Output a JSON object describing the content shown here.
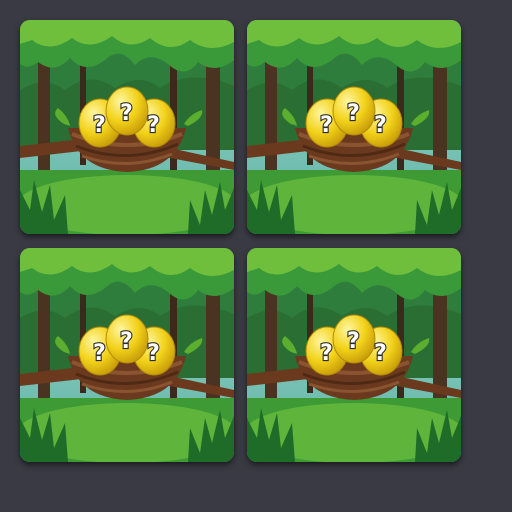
{
  "board": {
    "background": "#3a3a44",
    "cards": [
      {
        "name": "card-1",
        "egg_marks": [
          "?",
          "?",
          "?"
        ]
      },
      {
        "name": "card-2",
        "egg_marks": [
          "?",
          "?",
          "?"
        ]
      },
      {
        "name": "card-3",
        "egg_marks": [
          "?",
          "?",
          "?"
        ]
      },
      {
        "name": "card-4",
        "egg_marks": [
          "?",
          "?",
          "?"
        ]
      }
    ]
  },
  "colors": {
    "sky": "#8fd0cf",
    "forest_dark": "#1e5a2a",
    "forest_mid": "#2f8a3a",
    "leaf_light": "#7cc23a",
    "grass": "#4da43a",
    "nest": "#6b3a1e",
    "egg": "#f2d21a"
  },
  "icons": [
    "nest-icon",
    "egg-icon",
    "question-mark-icon",
    "branch-icon",
    "tree-icon"
  ]
}
